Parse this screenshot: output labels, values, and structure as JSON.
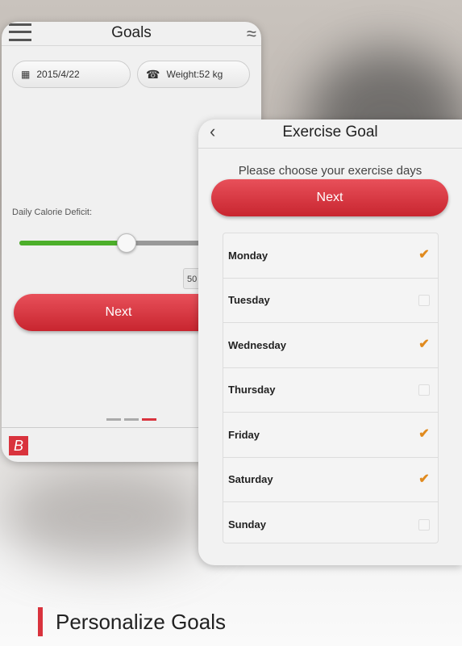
{
  "goals_screen": {
    "title": "Goals",
    "date": "2015/4/22",
    "weight": "Weight:52 kg",
    "deficit_label": "Daily Calorie Deficit:",
    "slider_value": 0.58,
    "value_box": "50",
    "next_label": "Next",
    "page_indicator": {
      "count": 3,
      "active": 3
    },
    "logo": "B"
  },
  "exercise_screen": {
    "title": "Exercise Goal",
    "prompt": "Please choose your exercise days",
    "next_label": "Next",
    "days": [
      {
        "label": "Monday",
        "checked": true
      },
      {
        "label": "Tuesday",
        "checked": false
      },
      {
        "label": "Wednesday",
        "checked": true
      },
      {
        "label": "Thursday",
        "checked": false
      },
      {
        "label": "Friday",
        "checked": true
      },
      {
        "label": "Saturday",
        "checked": true
      },
      {
        "label": "Sunday",
        "checked": false
      }
    ]
  },
  "caption": "Personalize Goals",
  "colors": {
    "accent": "#d9333d",
    "slider_fill": "#4caf2a",
    "check": "#e08a1e"
  }
}
